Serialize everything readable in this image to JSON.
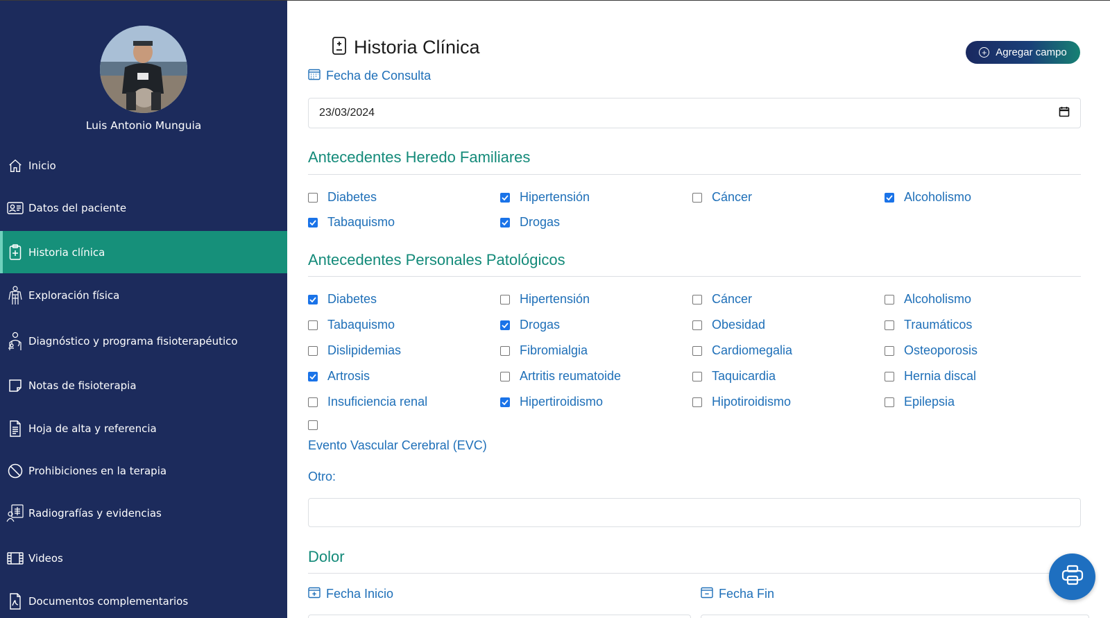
{
  "user": {
    "name": "Luis Antonio Munguia"
  },
  "sidebar": {
    "items": [
      {
        "label": "Inicio",
        "icon": "home-icon"
      },
      {
        "label": "Datos del paciente",
        "icon": "id-card-icon"
      },
      {
        "label": "Historia clínica",
        "icon": "clipboard-plus-icon",
        "active": true
      },
      {
        "label": "Exploración física",
        "icon": "body-icon"
      },
      {
        "label": "Diagnóstico y programa fisioterapéutico",
        "icon": "doctor-icon"
      },
      {
        "label": "Notas de fisioterapia",
        "icon": "note-icon"
      },
      {
        "label": "Hoja de alta y referencia",
        "icon": "document-icon"
      },
      {
        "label": "Prohibiciones en la terapia",
        "icon": "prohibited-icon"
      },
      {
        "label": "Radiografías y evidencias",
        "icon": "xray-icon"
      },
      {
        "label": "Videos",
        "icon": "film-icon"
      },
      {
        "label": "Documentos complementarios",
        "icon": "pdf-icon"
      }
    ]
  },
  "colors": {
    "sidebar": "#1c2b5c",
    "active": "#16907a",
    "accent": "#1e6fb8",
    "section": "#138a79"
  },
  "main": {
    "title": "Historia Clínica",
    "add_button": "Agregar campo",
    "consulta_label": "Fecha de Consulta",
    "consulta_value": "23/03/2024",
    "heredo": {
      "title": "Antecedentes Heredo Familiares",
      "items": [
        {
          "label": "Diabetes",
          "checked": false
        },
        {
          "label": "Hipertensión",
          "checked": true
        },
        {
          "label": "Cáncer",
          "checked": false
        },
        {
          "label": "Alcoholismo",
          "checked": true
        },
        {
          "label": "Tabaquismo",
          "checked": true
        },
        {
          "label": "Drogas",
          "checked": true
        }
      ]
    },
    "personales": {
      "title": "Antecedentes Personales Patológicos",
      "items": [
        {
          "label": "Diabetes",
          "checked": true
        },
        {
          "label": "Hipertensión",
          "checked": false
        },
        {
          "label": "Cáncer",
          "checked": false
        },
        {
          "label": "Alcoholismo",
          "checked": false
        },
        {
          "label": "Tabaquismo",
          "checked": false
        },
        {
          "label": "Drogas",
          "checked": true
        },
        {
          "label": "Obesidad",
          "checked": false
        },
        {
          "label": "Traumáticos",
          "checked": false
        },
        {
          "label": "Dislipidemias",
          "checked": false
        },
        {
          "label": "Fibromialgia",
          "checked": false
        },
        {
          "label": "Cardiomegalia",
          "checked": false
        },
        {
          "label": "Osteoporosis",
          "checked": false
        },
        {
          "label": "Artrosis",
          "checked": true
        },
        {
          "label": "Artritis reumatoide",
          "checked": false
        },
        {
          "label": "Taquicardia",
          "checked": false
        },
        {
          "label": "Hernia discal",
          "checked": false
        },
        {
          "label": "Insuficiencia renal",
          "checked": false
        },
        {
          "label": "Hipertiroidismo",
          "checked": true
        },
        {
          "label": "Hipotiroidismo",
          "checked": false
        },
        {
          "label": "Epilepsia",
          "checked": false
        }
      ],
      "evc": {
        "label": "Evento Vascular Cerebral (EVC)",
        "checked": false
      },
      "otro_label": "Otro:",
      "otro_value": ""
    },
    "dolor": {
      "title": "Dolor",
      "inicio_label": "Fecha Inicio",
      "fin_label": "Fecha Fin"
    }
  }
}
